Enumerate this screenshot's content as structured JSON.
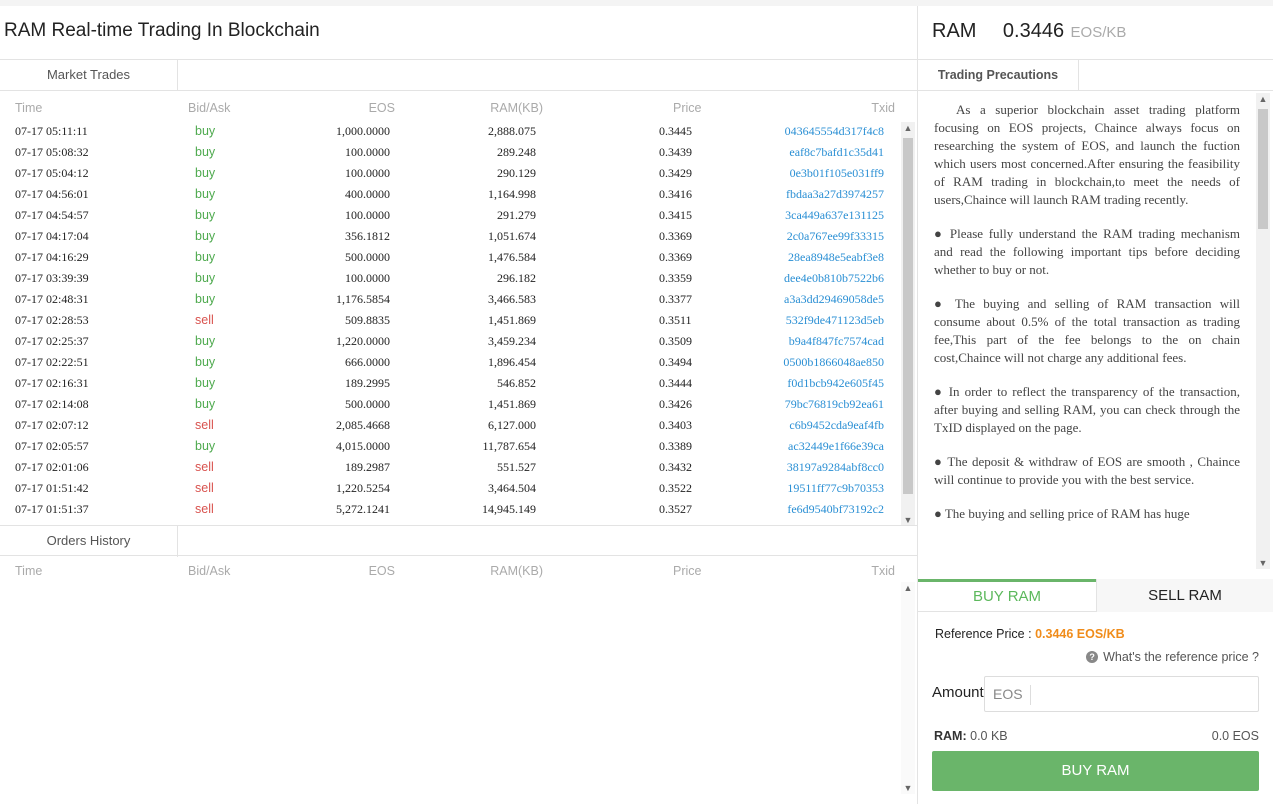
{
  "page": {
    "title": "RAM Real-time Trading In Blockchain"
  },
  "market": {
    "tab_label": "Market Trades",
    "columns": {
      "time": "Time",
      "side": "Bid/Ask",
      "eos": "EOS",
      "ram": "RAM(KB)",
      "price": "Price",
      "txid": "Txid"
    },
    "trades": [
      {
        "time": "07-17 05:11:11",
        "side": "buy",
        "eos": "1,000.0000",
        "ram": "2,888.075",
        "price": "0.3445",
        "txid": "043645554d317f4c8"
      },
      {
        "time": "07-17 05:08:32",
        "side": "buy",
        "eos": "100.0000",
        "ram": "289.248",
        "price": "0.3439",
        "txid": "eaf8c7bafd1c35d41"
      },
      {
        "time": "07-17 05:04:12",
        "side": "buy",
        "eos": "100.0000",
        "ram": "290.129",
        "price": "0.3429",
        "txid": "0e3b01f105e031ff9"
      },
      {
        "time": "07-17 04:56:01",
        "side": "buy",
        "eos": "400.0000",
        "ram": "1,164.998",
        "price": "0.3416",
        "txid": "fbdaa3a27d3974257"
      },
      {
        "time": "07-17 04:54:57",
        "side": "buy",
        "eos": "100.0000",
        "ram": "291.279",
        "price": "0.3415",
        "txid": "3ca449a637e131125"
      },
      {
        "time": "07-17 04:17:04",
        "side": "buy",
        "eos": "356.1812",
        "ram": "1,051.674",
        "price": "0.3369",
        "txid": "2c0a767ee99f33315"
      },
      {
        "time": "07-17 04:16:29",
        "side": "buy",
        "eos": "500.0000",
        "ram": "1,476.584",
        "price": "0.3369",
        "txid": "28ea8948e5eabf3e8"
      },
      {
        "time": "07-17 03:39:39",
        "side": "buy",
        "eos": "100.0000",
        "ram": "296.182",
        "price": "0.3359",
        "txid": "dee4e0b810b7522b6"
      },
      {
        "time": "07-17 02:48:31",
        "side": "buy",
        "eos": "1,176.5854",
        "ram": "3,466.583",
        "price": "0.3377",
        "txid": "a3a3dd29469058de5"
      },
      {
        "time": "07-17 02:28:53",
        "side": "sell",
        "eos": "509.8835",
        "ram": "1,451.869",
        "price": "0.3511",
        "txid": "532f9de471123d5eb"
      },
      {
        "time": "07-17 02:25:37",
        "side": "buy",
        "eos": "1,220.0000",
        "ram": "3,459.234",
        "price": "0.3509",
        "txid": "b9a4f847fc7574cad"
      },
      {
        "time": "07-17 02:22:51",
        "side": "buy",
        "eos": "666.0000",
        "ram": "1,896.454",
        "price": "0.3494",
        "txid": "0500b1866048ae850"
      },
      {
        "time": "07-17 02:16:31",
        "side": "buy",
        "eos": "189.2995",
        "ram": "546.852",
        "price": "0.3444",
        "txid": "f0d1bcb942e605f45"
      },
      {
        "time": "07-17 02:14:08",
        "side": "buy",
        "eos": "500.0000",
        "ram": "1,451.869",
        "price": "0.3426",
        "txid": "79bc76819cb92ea61"
      },
      {
        "time": "07-17 02:07:12",
        "side": "sell",
        "eos": "2,085.4668",
        "ram": "6,127.000",
        "price": "0.3403",
        "txid": "c6b9452cda9eaf4fb"
      },
      {
        "time": "07-17 02:05:57",
        "side": "buy",
        "eos": "4,015.0000",
        "ram": "11,787.654",
        "price": "0.3389",
        "txid": "ac32449e1f66e39ca"
      },
      {
        "time": "07-17 02:01:06",
        "side": "sell",
        "eos": "189.2987",
        "ram": "551.527",
        "price": "0.3432",
        "txid": "38197a9284abf8cc0"
      },
      {
        "time": "07-17 01:51:42",
        "side": "sell",
        "eos": "1,220.5254",
        "ram": "3,464.504",
        "price": "0.3522",
        "txid": "19511ff77c9b70353"
      },
      {
        "time": "07-17 01:51:37",
        "side": "sell",
        "eos": "5,272.1241",
        "ram": "14,945.149",
        "price": "0.3527",
        "txid": "fe6d9540bf73192c2"
      }
    ]
  },
  "orders": {
    "tab_label": "Orders History",
    "columns": {
      "time": "Time",
      "side": "Bid/Ask",
      "eos": "EOS",
      "ram": "RAM(KB)",
      "price": "Price",
      "txid": "Txid"
    }
  },
  "ticker": {
    "label": "RAM",
    "price": "0.3446",
    "unit": "EOS/KB"
  },
  "precautions": {
    "tab_label": "Trading Precautions",
    "paragraphs": [
      "As a superior blockchain asset trading platform focusing on EOS projects, Chaince always focus on researching the system of EOS, and launch the fuction which users most concerned.After ensuring the feasibility of RAM trading in blockchain,to meet the needs of users,Chaince will launch RAM trading recently.",
      "●  Please fully understand the RAM trading mechanism and read the following important tips before deciding whether to buy or not.",
      "●  The buying and selling of RAM transaction will consume about 0.5% of the total transaction as trading fee,This part of the fee belongs to the on chain cost,Chaince will not charge any additional fees.",
      "●  In order to reflect the transparency of the transaction, after buying and selling RAM, you can check through the TxID displayed on the page.",
      "●  The deposit & withdraw of EOS are smooth , Chaince will continue to provide you with the best service.",
      "●  The buying and selling price of RAM has huge"
    ]
  },
  "trade": {
    "buy_tab": "BUY RAM",
    "sell_tab": "SELL RAM",
    "reference_label": "Reference Price :",
    "reference_value": "0.3446 EOS/KB",
    "whats_reference": "What's the reference price ?",
    "amount_label": "Amount",
    "amount_unit": "EOS",
    "amount_value": "",
    "ram_label": "RAM:",
    "ram_value": "0.0 KB",
    "eos_value": "0.0 EOS",
    "buy_button": "BUY RAM"
  },
  "colors": {
    "buy": "#4faa4f",
    "sell": "#d9534f",
    "txid": "#2a8fd4",
    "accent": "#6ab56a",
    "reference": "#f08c1a"
  }
}
